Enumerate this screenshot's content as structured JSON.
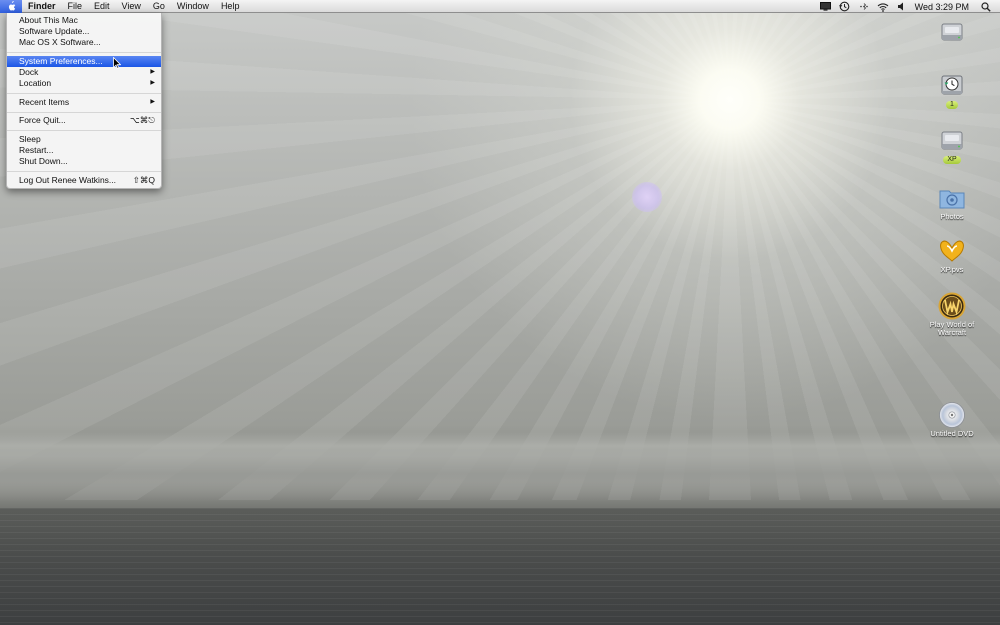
{
  "menubar": {
    "app_name": "Finder",
    "menus": [
      "File",
      "Edit",
      "View",
      "Go",
      "Window",
      "Help"
    ],
    "clock": "Wed 3:29 PM",
    "status_icons": [
      "display-icon",
      "time-machine-icon",
      "bluetooth-icon",
      "wifi-icon",
      "volume-icon",
      "spotlight-icon"
    ]
  },
  "apple_menu": {
    "items": {
      "about": "About This Mac",
      "software_update": "Software Update...",
      "mac_osx_software": "Mac OS X Software...",
      "system_preferences": "System Preferences...",
      "dock": "Dock",
      "location": "Location",
      "recent_items": "Recent Items",
      "force_quit": "Force Quit...",
      "force_quit_shortcut": "⌥⌘⎋",
      "sleep": "Sleep",
      "restart": "Restart...",
      "shut_down": "Shut Down...",
      "log_out": "Log Out Renee Watkins...",
      "log_out_shortcut": "⇧⌘Q"
    },
    "highlighted": "system_preferences"
  },
  "desktop_icons": {
    "hard_drive": {
      "label": ""
    },
    "time_machine": {
      "label": "1"
    },
    "xp_drive": {
      "label": "XP"
    },
    "photos": {
      "label": "Photos"
    },
    "xp_pvs": {
      "label": "XP.pvs"
    },
    "wow": {
      "label": "Play World of Warcraft"
    },
    "dvd": {
      "label": "Untitled DVD"
    }
  },
  "colors": {
    "menu_highlight": "#2a5ee8",
    "badge_green": "#b7d84a"
  }
}
